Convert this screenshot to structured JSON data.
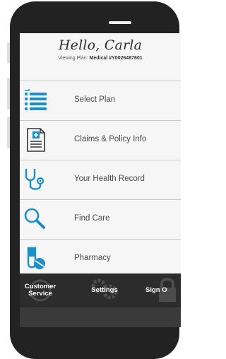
{
  "header": {
    "greeting": "Hello, Carla",
    "viewing_prefix": "Viewing Plan: ",
    "plan_name": "Medical #Y0026487601"
  },
  "menu": {
    "items": [
      {
        "label": "Select Plan",
        "icon": "list-icon"
      },
      {
        "label": "Claims & Policy Info",
        "icon": "document-plus-icon"
      },
      {
        "label": "Your Health Record",
        "icon": "stethoscope-icon"
      },
      {
        "label": "Find Care",
        "icon": "magnifier-icon"
      },
      {
        "label": "Pharmacy",
        "icon": "pill-icon"
      }
    ]
  },
  "tabbar": {
    "customer_service": "Customer\nService",
    "settings": "Settings",
    "sign_out": "Sign O"
  },
  "colors": {
    "accent": "#1e8fc6",
    "tabbar": "#2c2c2c",
    "background": "#f6f6f6"
  }
}
